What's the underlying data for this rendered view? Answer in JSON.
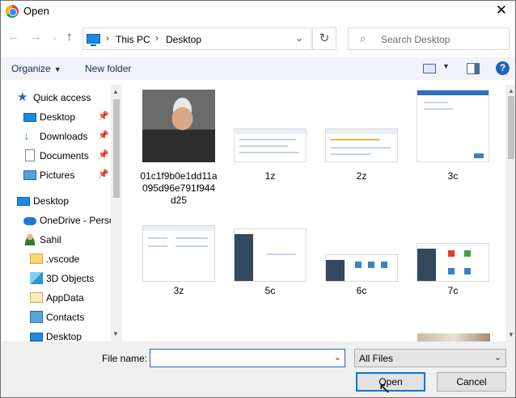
{
  "window": {
    "title": "Open"
  },
  "address": {
    "crumbs": [
      "This PC",
      "Desktop"
    ],
    "search_placeholder": "Search Desktop"
  },
  "toolbar": {
    "organize": "Organize",
    "new_folder": "New folder",
    "help": "?"
  },
  "nav": {
    "quick_access": "Quick access",
    "items": [
      {
        "label": "Desktop",
        "icon": "desktop-icon",
        "pinned": true
      },
      {
        "label": "Downloads",
        "icon": "download-icon",
        "pinned": true
      },
      {
        "label": "Documents",
        "icon": "document-icon",
        "pinned": true
      },
      {
        "label": "Pictures",
        "icon": "pictures-icon",
        "pinned": true
      }
    ],
    "tree": [
      {
        "label": "Desktop",
        "icon": "desktop-icon"
      },
      {
        "label": "OneDrive - Perso",
        "icon": "cloud-icon"
      },
      {
        "label": "Sahil",
        "icon": "user-icon"
      },
      {
        "label": ".vscode",
        "icon": "folder-icon"
      },
      {
        "label": "3D Objects",
        "icon": "3d-objects-icon"
      },
      {
        "label": "AppData",
        "icon": "folder-icon"
      },
      {
        "label": "Contacts",
        "icon": "contacts-icon"
      },
      {
        "label": "Desktop",
        "icon": "desktop-icon"
      }
    ]
  },
  "files": [
    {
      "name": "01c1f9b0e1dd11a095d96e791f944d25"
    },
    {
      "name": "1z"
    },
    {
      "name": "2z"
    },
    {
      "name": "3c"
    },
    {
      "name": "3z"
    },
    {
      "name": "5c"
    },
    {
      "name": "6c"
    },
    {
      "name": "7c"
    }
  ],
  "bottom": {
    "file_name_label": "File name:",
    "file_name_value": "",
    "filter": "All Files",
    "open": "Open",
    "cancel": "Cancel"
  }
}
